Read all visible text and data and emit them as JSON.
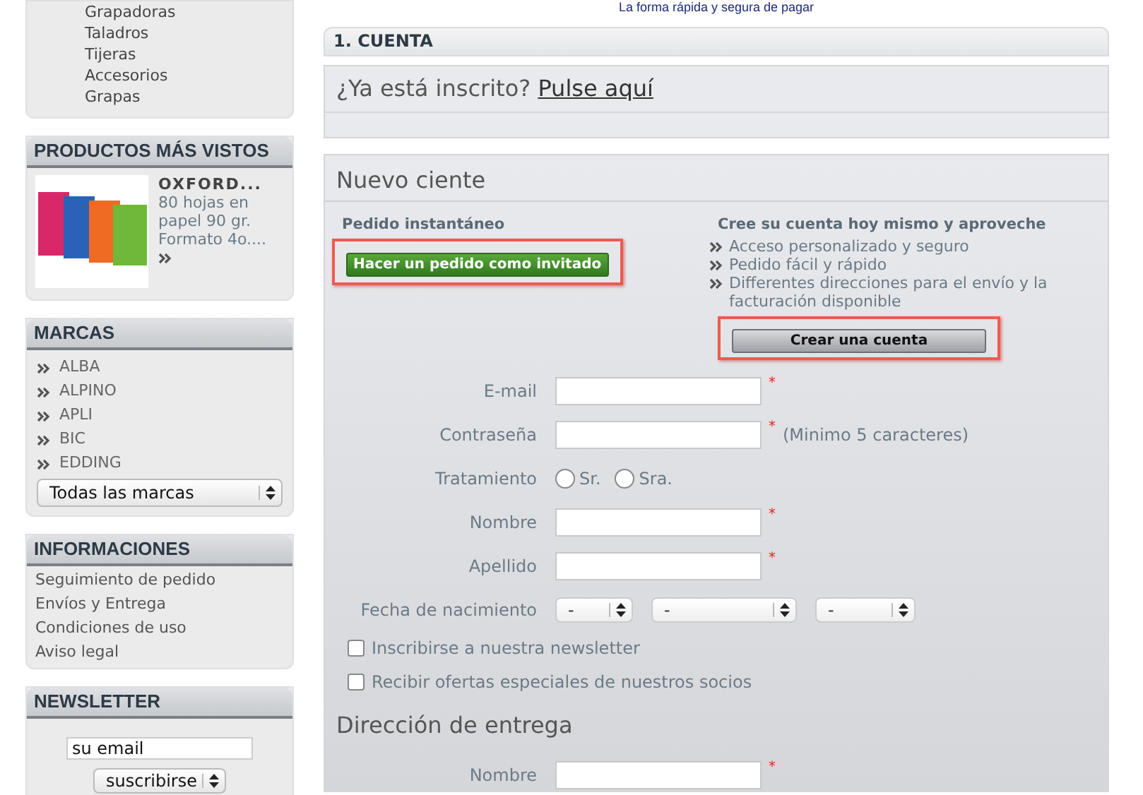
{
  "categories_box": {
    "items": [
      "Grapadoras",
      "Taladros",
      "Tijeras",
      "Accesorios",
      "Grapas"
    ]
  },
  "most_viewed": {
    "title": "PRODUCTOS MÁS VISTOS",
    "product": {
      "name": "OXFORD...",
      "description": "80 hojas en papel 90 gr. Formato 4o...."
    }
  },
  "brands": {
    "title": "MARCAS",
    "items": [
      "ALBA",
      "ALPINO",
      "APLI",
      "BIC",
      "EDDING"
    ],
    "select": "Todas las marcas"
  },
  "info": {
    "title": "INFORMACIONES",
    "links": [
      "Seguimiento de pedido",
      "Envíos y Entrega",
      "Condiciones de uso",
      "Aviso legal"
    ]
  },
  "newsletter": {
    "title": "NEWSLETTER",
    "email_placeholder": "su email",
    "action": "suscribirse"
  },
  "tagline": "La forma rápida y segura de pagar",
  "section_title": "1. CUENTA",
  "login_prompt": {
    "text": "¿Ya está inscrito?",
    "link": "Pulse aquí"
  },
  "new_customer": {
    "title": "Nuevo ciente",
    "guest": {
      "heading": "Pedido instantáneo",
      "button": "Hacer un pedido como invitado",
      "highlighted": true
    },
    "register": {
      "heading": "Cree su cuenta hoy mismo y aproveche",
      "benefits": [
        "Acceso personalizado y seguro",
        "Pedido fácil y rápido",
        "Differentes direcciones para el envío y la facturación disponible"
      ],
      "button": "Crear una cuenta",
      "highlighted": true
    },
    "fields": [
      {
        "kind": "text",
        "label": "E-mail",
        "mark": "*"
      },
      {
        "kind": "text",
        "label": "Contraseña",
        "mark": "*",
        "hint": "(Minimo 5 caracteres)"
      },
      {
        "kind": "radio",
        "label": "Tratamiento",
        "options": [
          {
            "label": "Sr.",
            "selected": false
          },
          {
            "label": "Sra.",
            "selected": false
          }
        ]
      },
      {
        "kind": "text",
        "label": "Nombre",
        "mark": "*"
      },
      {
        "kind": "text",
        "label": "Apellido",
        "mark": "*"
      },
      {
        "kind": "date",
        "label": "Fecha de nacimiento",
        "selects": [
          "-",
          "-",
          "-"
        ]
      }
    ],
    "checkboxes": [
      {
        "label": "Inscribirse a nuestra newsletter",
        "checked": false
      },
      {
        "label": "Recibir ofertas especiales de nuestros socios",
        "checked": false
      }
    ],
    "delivery": {
      "title": "Dirección de entrega",
      "fields": [
        {
          "kind": "text",
          "label": "Nombre",
          "mark": "*"
        }
      ]
    }
  }
}
